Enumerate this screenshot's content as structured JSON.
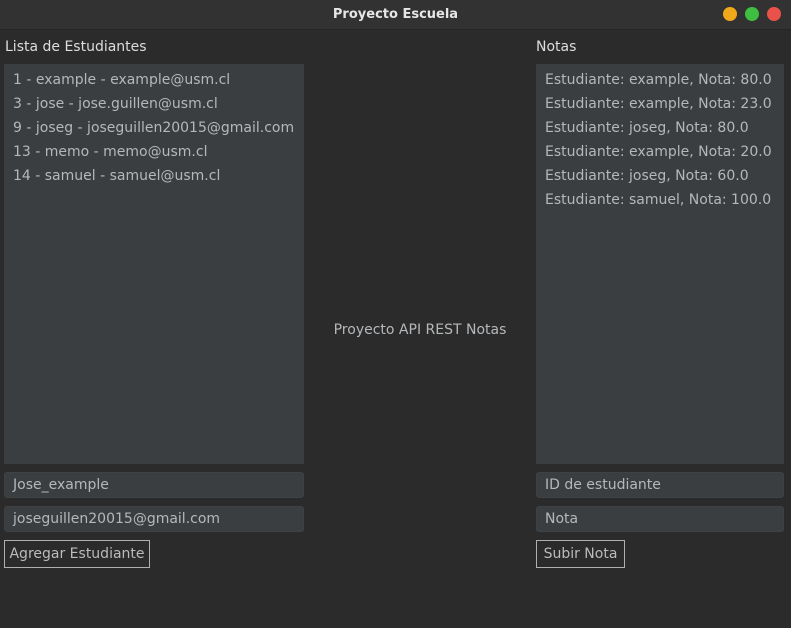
{
  "window": {
    "title": "Proyecto Escuela"
  },
  "students": {
    "heading": "Lista de Estudiantes",
    "items": [
      "1 - example - example@usm.cl",
      "3 - jose - jose.guillen@usm.cl",
      "9 - joseg - joseguillen20015@gmail.com",
      "13 - memo - memo@usm.cl",
      "14 - samuel - samuel@usm.cl"
    ],
    "name_input": {
      "value": "Jose_example"
    },
    "email_input": {
      "value": "joseguillen20015@gmail.com"
    },
    "add_button": "Agregar Estudiante"
  },
  "center": {
    "label": "Proyecto API REST Notas"
  },
  "grades": {
    "heading": "Notas",
    "items": [
      "Estudiante: example, Nota: 80.0",
      "Estudiante: example, Nota: 23.0",
      "Estudiante: joseg, Nota: 80.0",
      "Estudiante: example, Nota: 20.0",
      "Estudiante: joseg, Nota: 60.0",
      "Estudiante: samuel, Nota: 100.0"
    ],
    "id_input": {
      "placeholder": "ID de estudiante"
    },
    "grade_input": {
      "placeholder": "Nota"
    },
    "submit_button": "Subir Nota"
  },
  "colors": {
    "background": "#2b2b2b",
    "titlebar": "#323232",
    "panel": "#3b3e41",
    "window_minimize": "#f0a91a",
    "window_maximize": "#3fbf3f",
    "window_close": "#e9514b"
  },
  "icons": {
    "minimize": "minimize-icon",
    "maximize": "maximize-icon",
    "close": "close-icon"
  }
}
